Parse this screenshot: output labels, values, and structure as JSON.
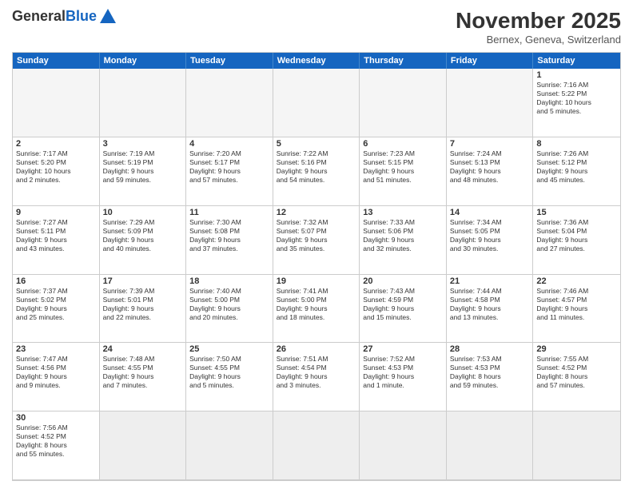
{
  "header": {
    "logo_general": "General",
    "logo_blue": "Blue",
    "month_year": "November 2025",
    "location": "Bernex, Geneva, Switzerland"
  },
  "day_headers": [
    "Sunday",
    "Monday",
    "Tuesday",
    "Wednesday",
    "Thursday",
    "Friday",
    "Saturday"
  ],
  "cells": [
    {
      "date": "",
      "info": "",
      "empty": true
    },
    {
      "date": "",
      "info": "",
      "empty": true
    },
    {
      "date": "",
      "info": "",
      "empty": true
    },
    {
      "date": "",
      "info": "",
      "empty": true
    },
    {
      "date": "",
      "info": "",
      "empty": true
    },
    {
      "date": "",
      "info": "",
      "empty": true
    },
    {
      "date": "1",
      "info": "Sunrise: 7:16 AM\nSunset: 5:22 PM\nDaylight: 10 hours\nand 5 minutes."
    },
    {
      "date": "2",
      "info": "Sunrise: 7:17 AM\nSunset: 5:20 PM\nDaylight: 10 hours\nand 2 minutes."
    },
    {
      "date": "3",
      "info": "Sunrise: 7:19 AM\nSunset: 5:19 PM\nDaylight: 9 hours\nand 59 minutes."
    },
    {
      "date": "4",
      "info": "Sunrise: 7:20 AM\nSunset: 5:17 PM\nDaylight: 9 hours\nand 57 minutes."
    },
    {
      "date": "5",
      "info": "Sunrise: 7:22 AM\nSunset: 5:16 PM\nDaylight: 9 hours\nand 54 minutes."
    },
    {
      "date": "6",
      "info": "Sunrise: 7:23 AM\nSunset: 5:15 PM\nDaylight: 9 hours\nand 51 minutes."
    },
    {
      "date": "7",
      "info": "Sunrise: 7:24 AM\nSunset: 5:13 PM\nDaylight: 9 hours\nand 48 minutes."
    },
    {
      "date": "8",
      "info": "Sunrise: 7:26 AM\nSunset: 5:12 PM\nDaylight: 9 hours\nand 45 minutes."
    },
    {
      "date": "9",
      "info": "Sunrise: 7:27 AM\nSunset: 5:11 PM\nDaylight: 9 hours\nand 43 minutes."
    },
    {
      "date": "10",
      "info": "Sunrise: 7:29 AM\nSunset: 5:09 PM\nDaylight: 9 hours\nand 40 minutes."
    },
    {
      "date": "11",
      "info": "Sunrise: 7:30 AM\nSunset: 5:08 PM\nDaylight: 9 hours\nand 37 minutes."
    },
    {
      "date": "12",
      "info": "Sunrise: 7:32 AM\nSunset: 5:07 PM\nDaylight: 9 hours\nand 35 minutes."
    },
    {
      "date": "13",
      "info": "Sunrise: 7:33 AM\nSunset: 5:06 PM\nDaylight: 9 hours\nand 32 minutes."
    },
    {
      "date": "14",
      "info": "Sunrise: 7:34 AM\nSunset: 5:05 PM\nDaylight: 9 hours\nand 30 minutes."
    },
    {
      "date": "15",
      "info": "Sunrise: 7:36 AM\nSunset: 5:04 PM\nDaylight: 9 hours\nand 27 minutes."
    },
    {
      "date": "16",
      "info": "Sunrise: 7:37 AM\nSunset: 5:02 PM\nDaylight: 9 hours\nand 25 minutes."
    },
    {
      "date": "17",
      "info": "Sunrise: 7:39 AM\nSunset: 5:01 PM\nDaylight: 9 hours\nand 22 minutes."
    },
    {
      "date": "18",
      "info": "Sunrise: 7:40 AM\nSunset: 5:00 PM\nDaylight: 9 hours\nand 20 minutes."
    },
    {
      "date": "19",
      "info": "Sunrise: 7:41 AM\nSunset: 5:00 PM\nDaylight: 9 hours\nand 18 minutes."
    },
    {
      "date": "20",
      "info": "Sunrise: 7:43 AM\nSunset: 4:59 PM\nDaylight: 9 hours\nand 15 minutes."
    },
    {
      "date": "21",
      "info": "Sunrise: 7:44 AM\nSunset: 4:58 PM\nDaylight: 9 hours\nand 13 minutes."
    },
    {
      "date": "22",
      "info": "Sunrise: 7:46 AM\nSunset: 4:57 PM\nDaylight: 9 hours\nand 11 minutes."
    },
    {
      "date": "23",
      "info": "Sunrise: 7:47 AM\nSunset: 4:56 PM\nDaylight: 9 hours\nand 9 minutes."
    },
    {
      "date": "24",
      "info": "Sunrise: 7:48 AM\nSunset: 4:55 PM\nDaylight: 9 hours\nand 7 minutes."
    },
    {
      "date": "25",
      "info": "Sunrise: 7:50 AM\nSunset: 4:55 PM\nDaylight: 9 hours\nand 5 minutes."
    },
    {
      "date": "26",
      "info": "Sunrise: 7:51 AM\nSunset: 4:54 PM\nDaylight: 9 hours\nand 3 minutes."
    },
    {
      "date": "27",
      "info": "Sunrise: 7:52 AM\nSunset: 4:53 PM\nDaylight: 9 hours\nand 1 minute."
    },
    {
      "date": "28",
      "info": "Sunrise: 7:53 AM\nSunset: 4:53 PM\nDaylight: 8 hours\nand 59 minutes."
    },
    {
      "date": "29",
      "info": "Sunrise: 7:55 AM\nSunset: 4:52 PM\nDaylight: 8 hours\nand 57 minutes."
    },
    {
      "date": "30",
      "info": "Sunrise: 7:56 AM\nSunset: 4:52 PM\nDaylight: 8 hours\nand 55 minutes."
    },
    {
      "date": "",
      "info": "",
      "empty": true,
      "shaded": true
    },
    {
      "date": "",
      "info": "",
      "empty": true,
      "shaded": true
    },
    {
      "date": "",
      "info": "",
      "empty": true,
      "shaded": true
    },
    {
      "date": "",
      "info": "",
      "empty": true,
      "shaded": true
    },
    {
      "date": "",
      "info": "",
      "empty": true,
      "shaded": true
    },
    {
      "date": "",
      "info": "",
      "empty": true,
      "shaded": true
    }
  ]
}
